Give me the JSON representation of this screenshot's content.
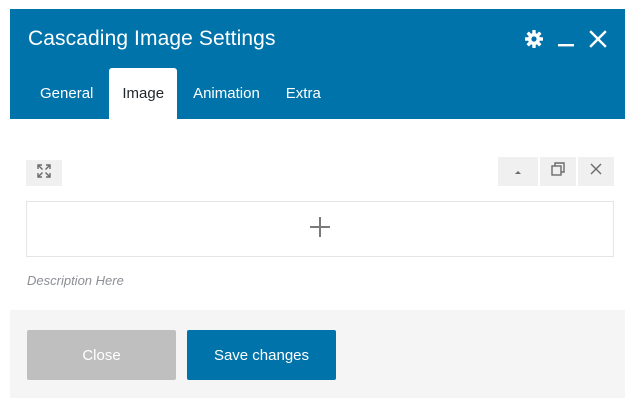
{
  "dialog": {
    "title": "Cascading Image Settings",
    "header_icons": [
      "gear-icon",
      "minimize-icon",
      "close-icon"
    ],
    "tabs": [
      {
        "label": "General",
        "active": false
      },
      {
        "label": "Image",
        "active": true
      },
      {
        "label": "Animation",
        "active": false
      },
      {
        "label": "Extra",
        "active": false
      }
    ]
  },
  "editor": {
    "left_tool_icon": "expand-icon",
    "right_tool_icons": [
      "caret-up-icon",
      "duplicate-icon",
      "close-icon"
    ],
    "add_icon": "plus-icon",
    "description": "Description Here"
  },
  "footer": {
    "close_label": "Close",
    "save_label": "Save changes"
  },
  "colors": {
    "primary": "#0073aa",
    "disabled": "#bfbfbf",
    "footer_bg": "#f5f5f5"
  }
}
